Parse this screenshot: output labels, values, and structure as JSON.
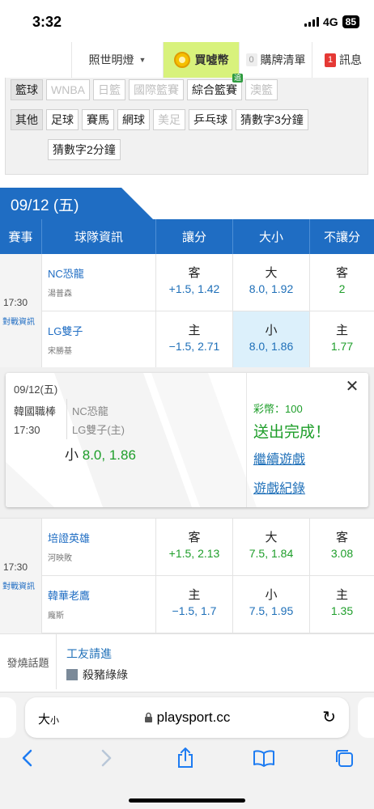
{
  "status": {
    "time": "3:32",
    "network": "4G",
    "battery": "85"
  },
  "topnav": {
    "light_label": "照世明燈",
    "coin_label": "買噓幣",
    "cart_count": "0",
    "cart_label": "購牌清單",
    "msg_count": "1",
    "msg_label": "訊息"
  },
  "categories": {
    "row1": {
      "label": "籃球",
      "items": [
        "WNBA",
        "日籃",
        "國際籃賽",
        "綜合籃賽",
        "澳籃"
      ],
      "new_badge": "追"
    },
    "row2": {
      "label": "其他",
      "items": [
        "足球",
        "賽馬",
        "網球",
        "美足",
        "乒乓球",
        "猜數字3分鐘"
      ]
    },
    "row3": {
      "items": [
        "猜數字2分鐘"
      ]
    }
  },
  "date_tab": "09/12 (五)",
  "table_header": {
    "event": "賽事",
    "team": "球隊資訊",
    "spread": "讓分",
    "total": "大小",
    "moneyline": "不讓分"
  },
  "games": [
    {
      "time": "17:30",
      "record_link": "對戰資訊",
      "away": {
        "name": "NC恐龍",
        "pitcher": "湯普森",
        "spread_k": "客",
        "spread_v": "+1.5, 1.42",
        "total_k": "大",
        "total_v": "8.0, 1.92",
        "ml_k": "客",
        "ml_v": "2"
      },
      "home": {
        "name": "LG雙子",
        "pitcher": "宋勝基",
        "spread_k": "主",
        "spread_v": "−1.5, 2.71",
        "total_k": "小",
        "total_v": "8.0, 1.86",
        "ml_k": "主",
        "ml_v": "1.77"
      }
    },
    {
      "time": "17:30",
      "record_link": "對戰資訊",
      "away": {
        "name": "培證英雄",
        "pitcher": "河映敗",
        "spread_k": "客",
        "spread_v": "+1.5, 2.13",
        "total_k": "大",
        "total_v": "7.5, 1.84",
        "ml_k": "客",
        "ml_v": "3.08"
      },
      "home": {
        "name": "韓華老鷹",
        "pitcher": "龐斯",
        "spread_k": "主",
        "spread_v": "−1.5, 1.7",
        "total_k": "小",
        "total_v": "7.5, 1.95",
        "ml_k": "主",
        "ml_v": "1.35"
      }
    }
  ],
  "popup": {
    "date": "09/12(五)",
    "league": "韓國職棒",
    "time": "17:30",
    "team1": "NC恐龍",
    "team2": "LG雙子(主)",
    "pick_label": "小",
    "pick_value": "8.0, 1.86",
    "coins": "彩幣：100",
    "done": "送出完成！",
    "continue_link": "繼續遊戲",
    "history_link": "遊戲紀錄",
    "close": "✕"
  },
  "hot_topic": {
    "label": "發燒話題",
    "title": "工友請進",
    "author": "殺豬綠綠"
  },
  "browser": {
    "text_size": "大",
    "text_size_small": "小",
    "url": "playsport.cc",
    "reload": "↻"
  },
  "colors": {
    "primary": "#1f6dc3",
    "green": "#1e9e2a",
    "coin_bg": "#d8f27c",
    "selected": "#dcf0fb"
  }
}
